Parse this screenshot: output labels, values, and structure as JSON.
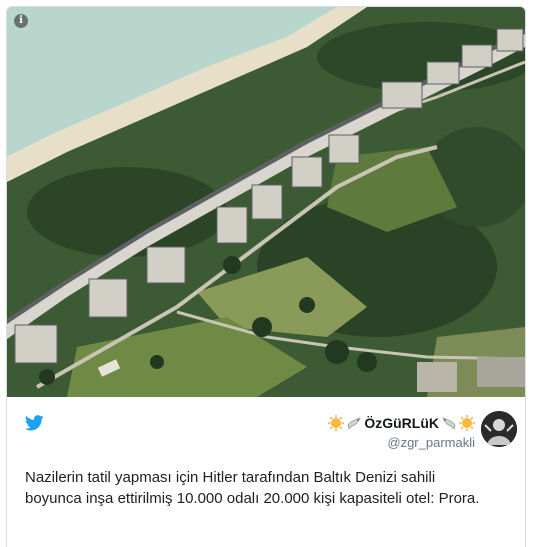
{
  "tweet": {
    "author_name": "ÖzGüRLüK",
    "author_handle": "@zgr_parmakli",
    "text": "Nazilerin tatil yapması için Hitler tarafından Baltık Denizi sahili boyunca inşa ettirilmiş 10.000 odalı 20.000 kişi kapasiteli otel: Prora.",
    "name_emojis": [
      "sun-emoji",
      "dove-emoji",
      "dove-emoji",
      "sun-emoji"
    ],
    "info_icon": "i"
  },
  "colors": {
    "twitter_blue": "#1da1f2",
    "sea": "#b4d2c8",
    "sand": "#e6ddc6",
    "forest": "#2f4a2a",
    "building_roof": "#6b6e70"
  }
}
